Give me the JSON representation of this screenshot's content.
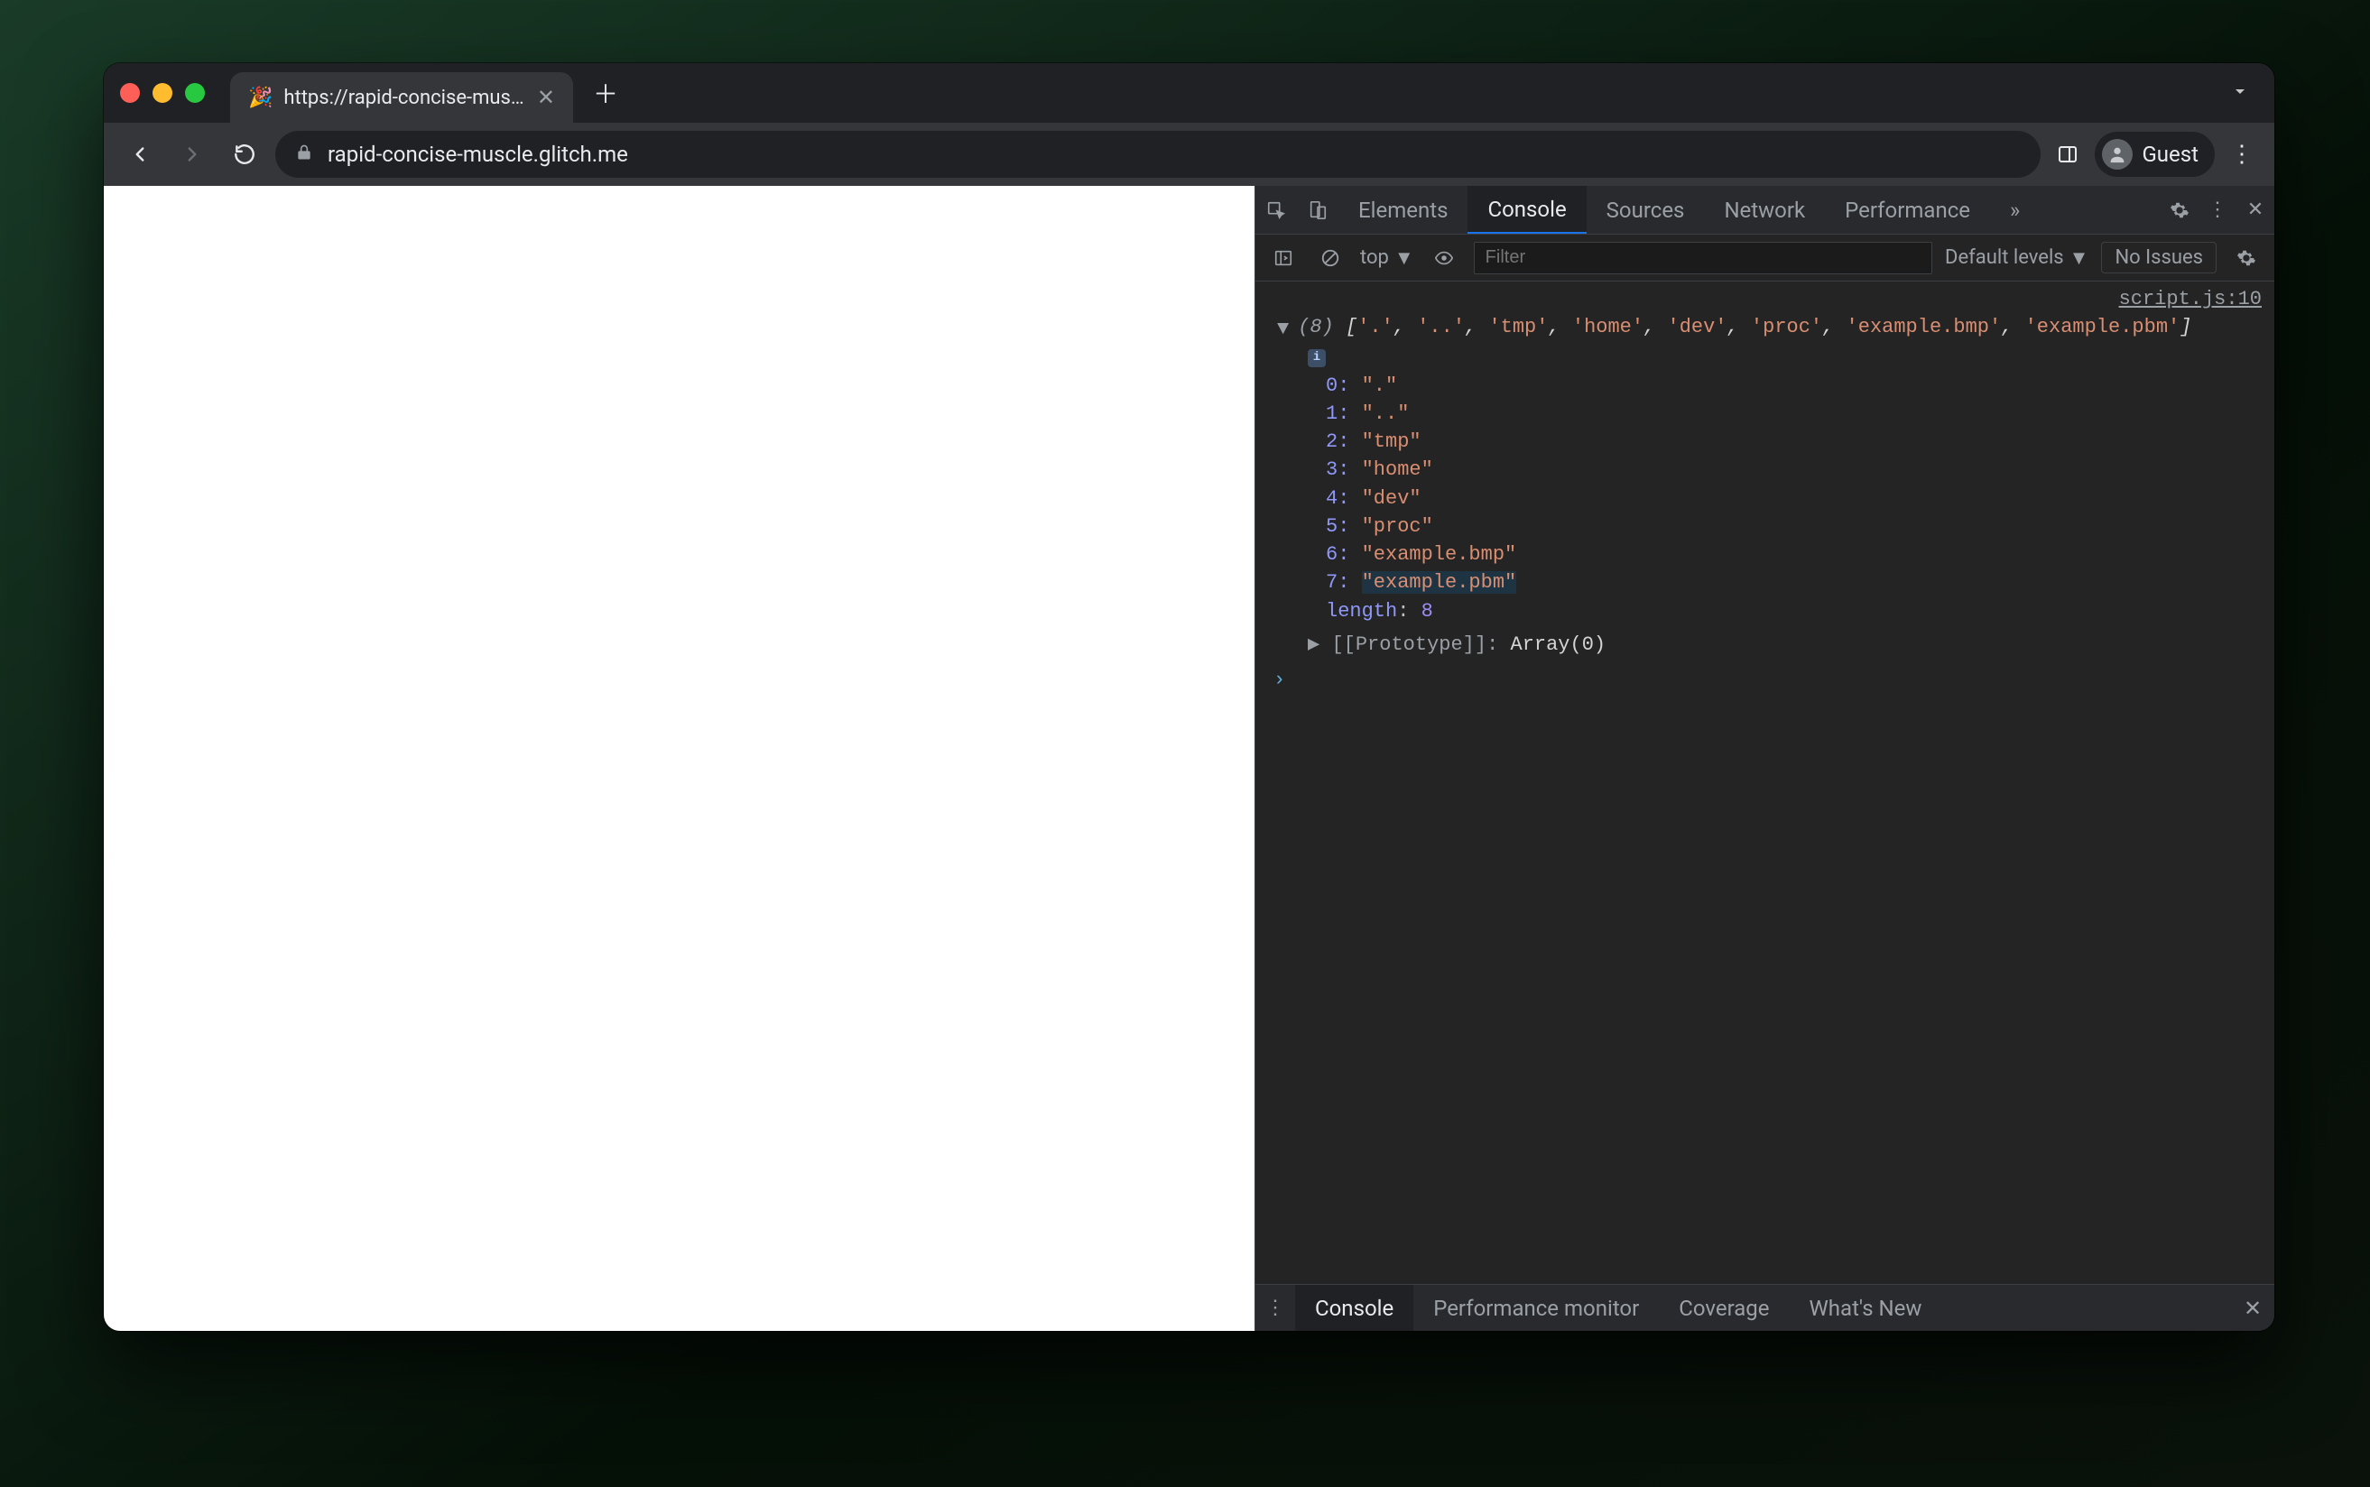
{
  "browser": {
    "tab": {
      "favicon": "🎉",
      "title": "https://rapid-concise-muscle.g…"
    },
    "url": "rapid-concise-muscle.glitch.me",
    "profile_label": "Guest"
  },
  "devtools": {
    "tabs": {
      "elements": "Elements",
      "console": "Console",
      "sources": "Sources",
      "network": "Network",
      "performance": "Performance",
      "more": "»"
    },
    "console_toolbar": {
      "context": "top",
      "filter_placeholder": "Filter",
      "levels": "Default levels",
      "issues": "No Issues"
    },
    "source_link": "script.js:10",
    "array": {
      "count": "(8)",
      "summary": "['.', '..', 'tmp', 'home', 'dev', 'proc', 'example.bmp', 'example.pbm']",
      "entries": [
        {
          "index": "0",
          "value": "\".\""
        },
        {
          "index": "1",
          "value": "\"..\""
        },
        {
          "index": "2",
          "value": "\"tmp\""
        },
        {
          "index": "3",
          "value": "\"home\""
        },
        {
          "index": "4",
          "value": "\"dev\""
        },
        {
          "index": "5",
          "value": "\"proc\""
        },
        {
          "index": "6",
          "value": "\"example.bmp\""
        },
        {
          "index": "7",
          "value": "\"example.pbm\""
        }
      ],
      "length_label": "length",
      "length_value": "8",
      "proto_label": "[[Prototype]]",
      "proto_value": "Array(0)"
    },
    "drawer": {
      "console": "Console",
      "perfmon": "Performance monitor",
      "coverage": "Coverage",
      "whatsnew": "What's New"
    }
  }
}
